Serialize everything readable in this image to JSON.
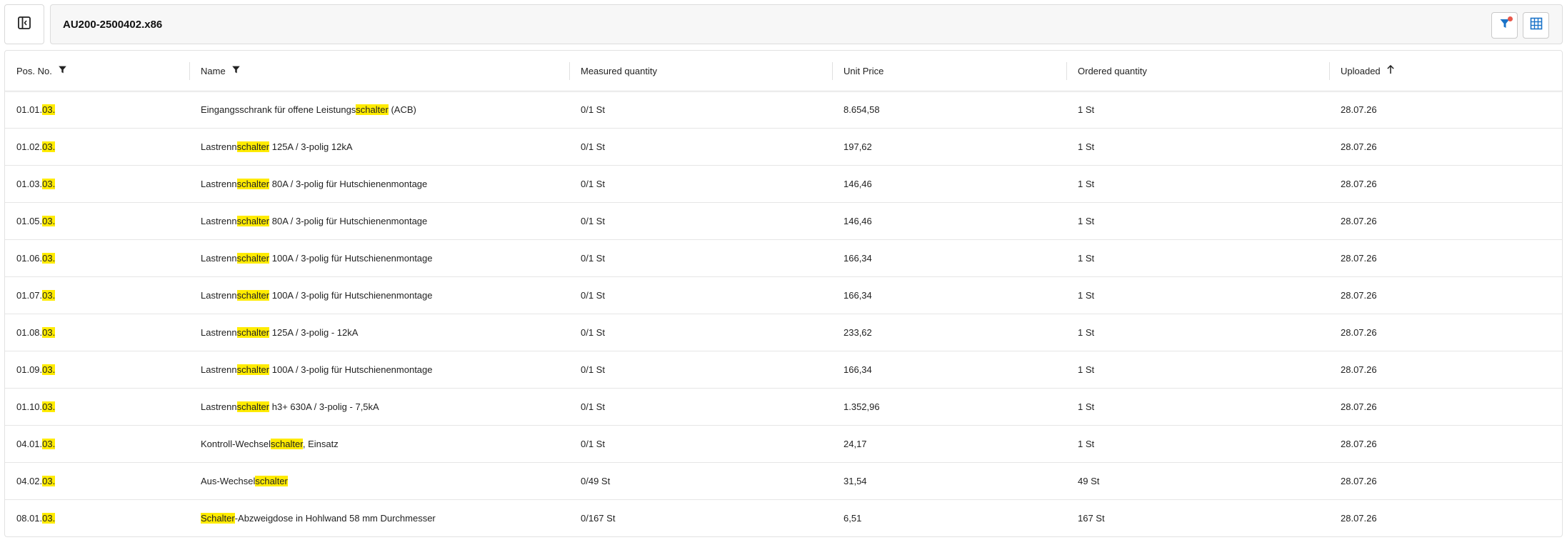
{
  "header": {
    "title": "AU200-2500402.x86"
  },
  "colors": {
    "highlight": "#ffeb00",
    "accent": "#1a73c8",
    "badge": "#e8574a"
  },
  "icons": {
    "sidebar_toggle": "sidebar-collapse-icon",
    "filter": "filter-icon",
    "grid": "table-grid-icon",
    "sort": "arrow-up-icon"
  },
  "table": {
    "columns": [
      "Pos. No.",
      "Name",
      "Measured quantity",
      "Unit Price",
      "Ordered quantity",
      "Uploaded"
    ],
    "rows": [
      {
        "pos": [
          "01.01.",
          "03.",
          ""
        ],
        "name": [
          "Eingangsschrank für offene Leistungs",
          "schalter",
          " (ACB)"
        ],
        "measured": "0/1 St",
        "price": "8.654,58",
        "ordered": "1 St",
        "uploaded": "28.07.26"
      },
      {
        "pos": [
          "01.02.",
          "03.",
          ""
        ],
        "name": [
          "Lastrenn",
          "schalter",
          " 125A / 3-polig 12kA"
        ],
        "measured": "0/1 St",
        "price": "197,62",
        "ordered": "1 St",
        "uploaded": "28.07.26"
      },
      {
        "pos": [
          "01.03.",
          "03.",
          ""
        ],
        "name": [
          "Lastrenn",
          "schalter",
          " 80A / 3-polig für Hutschienenmontage"
        ],
        "measured": "0/1 St",
        "price": "146,46",
        "ordered": "1 St",
        "uploaded": "28.07.26"
      },
      {
        "pos": [
          "01.05.",
          "03.",
          ""
        ],
        "name": [
          "Lastrenn",
          "schalter",
          " 80A / 3-polig für Hutschienenmontage"
        ],
        "measured": "0/1 St",
        "price": "146,46",
        "ordered": "1 St",
        "uploaded": "28.07.26"
      },
      {
        "pos": [
          "01.06.",
          "03.",
          ""
        ],
        "name": [
          "Lastrenn",
          "schalter",
          " 100A / 3-polig für Hutschienenmontage"
        ],
        "measured": "0/1 St",
        "price": "166,34",
        "ordered": "1 St",
        "uploaded": "28.07.26"
      },
      {
        "pos": [
          "01.07.",
          "03.",
          ""
        ],
        "name": [
          "Lastrenn",
          "schalter",
          " 100A / 3-polig für Hutschienenmontage"
        ],
        "measured": "0/1 St",
        "price": "166,34",
        "ordered": "1 St",
        "uploaded": "28.07.26"
      },
      {
        "pos": [
          "01.08.",
          "03.",
          ""
        ],
        "name": [
          "Lastrenn",
          "schalter",
          " 125A / 3-polig - 12kA"
        ],
        "measured": "0/1 St",
        "price": "233,62",
        "ordered": "1 St",
        "uploaded": "28.07.26"
      },
      {
        "pos": [
          "01.09.",
          "03.",
          ""
        ],
        "name": [
          "Lastrenn",
          "schalter",
          " 100A / 3-polig für Hutschienenmontage"
        ],
        "measured": "0/1 St",
        "price": "166,34",
        "ordered": "1 St",
        "uploaded": "28.07.26"
      },
      {
        "pos": [
          "01.10.",
          "03.",
          ""
        ],
        "name": [
          "Lastrenn",
          "schalter",
          " h3+ 630A / 3-polig - 7,5kA"
        ],
        "measured": "0/1 St",
        "price": "1.352,96",
        "ordered": "1 St",
        "uploaded": "28.07.26"
      },
      {
        "pos": [
          "04.01.",
          "03.",
          ""
        ],
        "name": [
          "Kontroll-Wechsel",
          "schalter",
          ", Einsatz"
        ],
        "measured": "0/1 St",
        "price": "24,17",
        "ordered": "1 St",
        "uploaded": "28.07.26"
      },
      {
        "pos": [
          "04.02.",
          "03.",
          ""
        ],
        "name": [
          "Aus-Wechsel",
          "schalter",
          ""
        ],
        "measured": "0/49 St",
        "price": "31,54",
        "ordered": "49 St",
        "uploaded": "28.07.26"
      },
      {
        "pos": [
          "08.01.",
          "03.",
          ""
        ],
        "name": [
          "",
          "Schalter",
          "-Abzweigdose in Hohlwand 58 mm Durchmesser"
        ],
        "measured": "0/167 St",
        "price": "6,51",
        "ordered": "167 St",
        "uploaded": "28.07.26"
      }
    ]
  }
}
